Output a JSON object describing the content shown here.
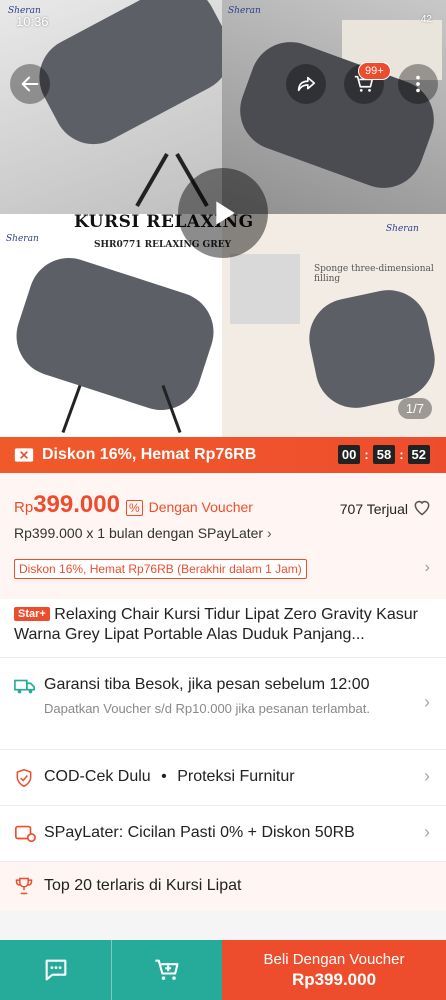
{
  "status_bar": {
    "time": "10:36",
    "right_text": "42"
  },
  "hero": {
    "badge_count": "99+",
    "kursi_title": "KURSI RELAXING",
    "kursi_sub": "SHR0771 RELAXING GREY",
    "brand": "Sheran",
    "feature_text": "Sponge three-dimensional filling",
    "page_indicator": "1/7"
  },
  "flash": {
    "discount_text": "Diskon 16%, Hemat Rp76RB",
    "timer_h": "00",
    "timer_m": "58",
    "timer_s": "52"
  },
  "price": {
    "currency": "Rp",
    "amount": "399.000",
    "voucher_label": "Dengan Voucher",
    "sold": "707 Terjual",
    "spaylater_line": "Rp399.000 x 1 bulan dengan SPayLater",
    "discount_tag": "Diskon 16%, Hemat Rp76RB (Berakhir dalam 1 Jam)"
  },
  "product": {
    "badge": "Star+",
    "title": "Relaxing Chair Kursi Tidur Lipat  Zero Gravity Kasur Warna Grey Lipat Portable Alas Duduk Panjang..."
  },
  "rows": {
    "shipping_main": "Garansi tiba Besok, jika pesan sebelum 12:00",
    "shipping_sub": "Dapatkan Voucher s/d Rp10.000 jika pesanan terlambat.",
    "cod": "COD-Cek Dulu",
    "dot": "•",
    "protection": "Proteksi Furnitur",
    "spaylater": "SPayLater: Cicilan Pasti 0% + Diskon 50RB",
    "top20": "Top 20 terlaris di Kursi Lipat"
  },
  "bottom_bar": {
    "buy_line1": "Beli Dengan Voucher",
    "buy_line2": "Rp399.000"
  },
  "colors": {
    "accent": "#ee4d2d",
    "teal": "#26aa99"
  }
}
